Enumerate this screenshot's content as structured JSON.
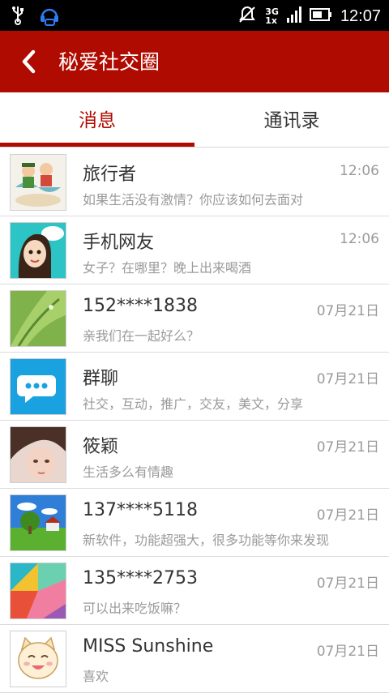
{
  "status_bar": {
    "time": "12:07",
    "network_top": "3G",
    "network_bottom": "1x"
  },
  "app_bar": {
    "title": "秘爱社交圈"
  },
  "tabs": [
    {
      "label": "消息",
      "active": true
    },
    {
      "label": "通讯录",
      "active": false
    }
  ],
  "colors": {
    "accent": "#b00b00",
    "name_text": "#333333",
    "secondary_text": "#9a9a9a"
  },
  "conversations": [
    {
      "name": "旅行者",
      "message": "如果生活没有激情？你应该如何去面对",
      "time": "12:06",
      "avatar": "travel-cartoon-avatar"
    },
    {
      "name": "手机网友",
      "message": "女子？在哪里？晚上出来喝酒",
      "time": "12:06",
      "avatar": "girl-cartoon-avatar"
    },
    {
      "name": "152****1838",
      "message": "亲我们在一起好么？",
      "time": "07月21日",
      "avatar": "green-leaf-avatar"
    },
    {
      "name": "群聊",
      "message": "社交，互动，推广，交友，美文，分享",
      "time": "07月21日",
      "avatar": "chat-bubble-avatar"
    },
    {
      "name": "筱颖",
      "message": "生活多么有情趣",
      "time": "07月21日",
      "avatar": "person-photo-avatar"
    },
    {
      "name": "137****5118",
      "message": "新软件，功能超强大，很多功能等你来发现",
      "time": "07月21日",
      "avatar": "landscape-avatar"
    },
    {
      "name": "135****2753",
      "message": "可以出来吃饭嘛？",
      "time": "07月21日",
      "avatar": "colorful-geometric-avatar"
    },
    {
      "name": "MISS Sunshine",
      "message": "喜欢",
      "time": "07月21日",
      "avatar": "cat-cartoon-avatar"
    }
  ]
}
